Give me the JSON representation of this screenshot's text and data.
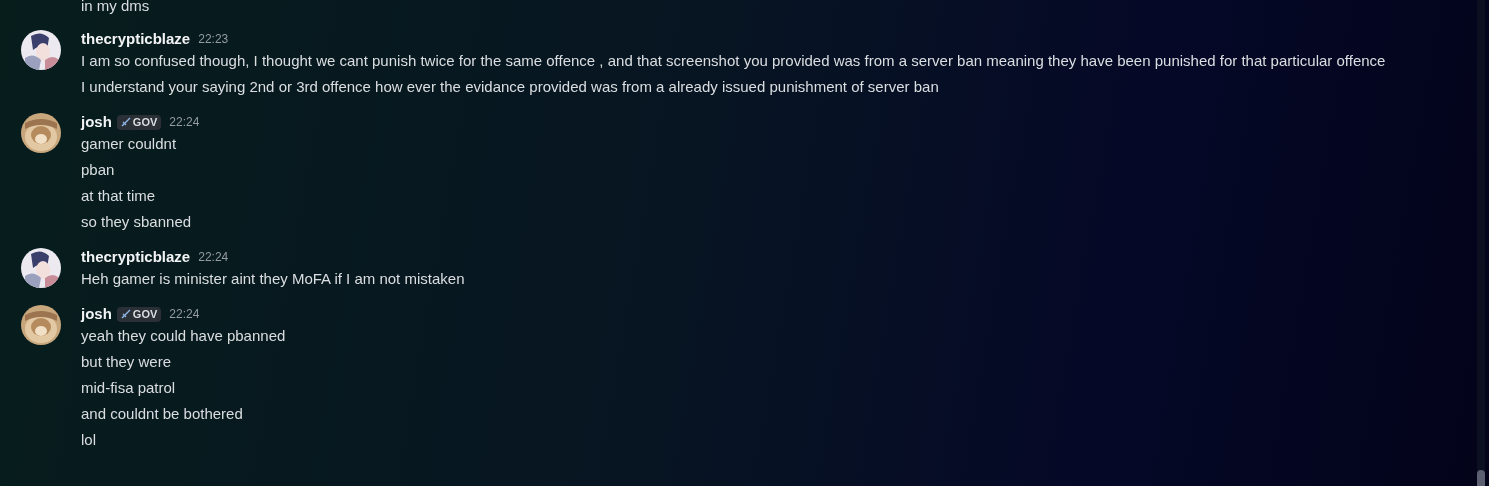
{
  "previous_message": {
    "lines": [
      "in my dms"
    ]
  },
  "messages": [
    {
      "author": "thecrypticblaze",
      "time": "22:23",
      "avatar": {
        "kind": "picture"
      },
      "lines": [
        "I am so confused though, I thought we cant punish twice for the same offence , and that screenshot you provided was from a server ban meaning they have been punished for that particular offence",
        "I understand your saying 2nd or 3rd offence how ever the evidance provided was from a already issued punishment of server ban"
      ]
    },
    {
      "author": "josh",
      "tag": "GOV",
      "time": "22:24",
      "avatar": {
        "kind": "picture"
      },
      "lines": [
        "gamer couldnt",
        "pban",
        "at that time",
        "so they sbanned"
      ]
    },
    {
      "author": "thecrypticblaze",
      "time": "22:24",
      "avatar": {
        "kind": "picture"
      },
      "lines": [
        "Heh gamer is minister aint they MoFA if I am not mistaken"
      ]
    },
    {
      "author": "josh",
      "tag": "GOV",
      "time": "22:24",
      "avatar": {
        "kind": "picture"
      },
      "lines": [
        "yeah they could have pbanned",
        "but they were",
        "mid-fisa patrol",
        "and couldnt be bothered",
        "lol"
      ]
    }
  ]
}
